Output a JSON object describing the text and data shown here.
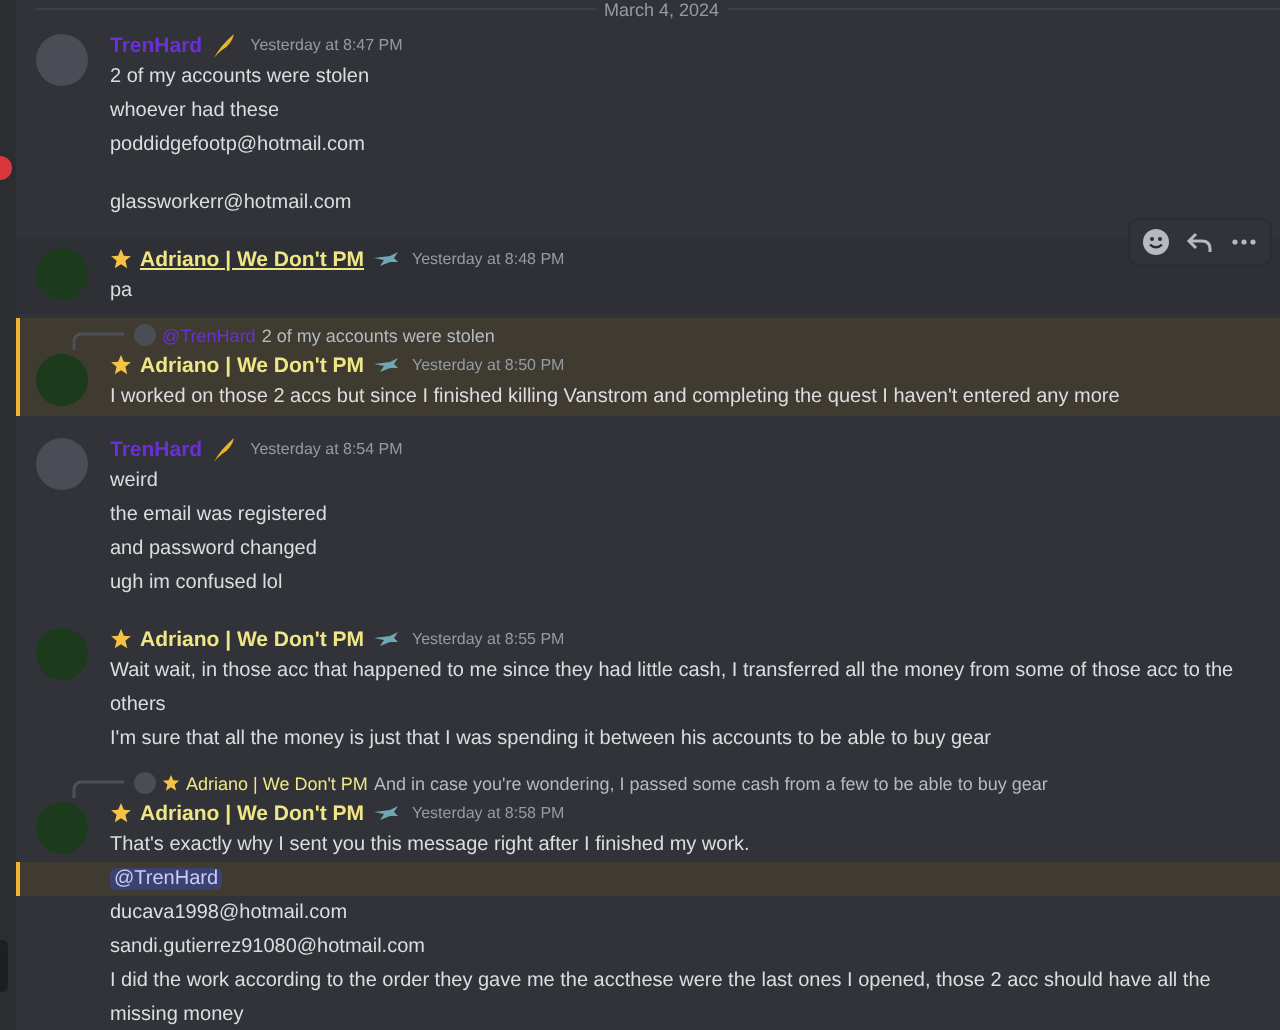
{
  "date_divider": "March 4, 2024",
  "messages": [
    {
      "author": "TrenHard",
      "color": "#6a2fd6",
      "star": false,
      "kind": "quill",
      "time": "Yesterday at 8:47 PM",
      "hovered": false,
      "highlighted": false,
      "lines": [
        {
          "kind": "text",
          "text": "2 of my accounts were stolen",
          "gap_before": false,
          "highlighted": false
        },
        {
          "kind": "text",
          "text": "whoever had these",
          "gap_before": false,
          "highlighted": false
        },
        {
          "kind": "text",
          "text": "poddidgefootp@hotmail.com",
          "gap_before": false,
          "highlighted": false
        },
        {
          "kind": "text",
          "text": "glassworkerr@hotmail.com",
          "gap_before": true,
          "highlighted": false
        }
      ]
    },
    {
      "author": "Adriano | We Don't PM",
      "color": "#f1e686",
      "star": true,
      "kind": "bird",
      "time": "Yesterday at 8:48 PM",
      "hovered": true,
      "highlighted": false,
      "lines": [
        {
          "kind": "text",
          "text": "pa",
          "gap_before": false,
          "highlighted": false
        }
      ]
    },
    {
      "author": "Adriano | We Don't PM",
      "color": "#f1e686",
      "star": true,
      "kind": "bird",
      "time": "Yesterday at 8:50 PM",
      "hovered": false,
      "highlighted": true,
      "reply": {
        "author": "@TrenHard",
        "color": "#6a2fd6",
        "star": false,
        "text": "2 of my accounts were stolen"
      },
      "lines": [
        {
          "kind": "text",
          "text": "I worked on those 2 accs but since I finished killing Vanstrom and completing the quest I haven't entered any more",
          "gap_before": false,
          "highlighted": false
        }
      ]
    },
    {
      "author": "TrenHard",
      "color": "#6a2fd6",
      "star": false,
      "kind": "quill",
      "time": "Yesterday at 8:54 PM",
      "hovered": false,
      "highlighted": false,
      "lines": [
        {
          "kind": "text",
          "text": "weird",
          "gap_before": false,
          "highlighted": false
        },
        {
          "kind": "text",
          "text": "the email was registered",
          "gap_before": false,
          "highlighted": false
        },
        {
          "kind": "text",
          "text": "and password changed",
          "gap_before": false,
          "highlighted": false
        },
        {
          "kind": "text",
          "text": "ugh im confused lol",
          "gap_before": false,
          "highlighted": false
        }
      ]
    },
    {
      "author": "Adriano | We Don't PM",
      "color": "#f1e686",
      "star": true,
      "kind": "bird",
      "time": "Yesterday at 8:55 PM",
      "hovered": false,
      "highlighted": false,
      "lines": [
        {
          "kind": "text",
          "text": "Wait wait, in those acc that happened to me since they had little cash, I transferred all the money from some of those acc to the others",
          "gap_before": false,
          "highlighted": false
        },
        {
          "kind": "text",
          "text": "I'm sure that all the money is just that I was spending it between his accounts to be able to buy gear",
          "gap_before": false,
          "highlighted": false
        }
      ]
    },
    {
      "author": "Adriano | We Don't PM",
      "color": "#f1e686",
      "star": true,
      "kind": "bird",
      "time": "Yesterday at 8:58 PM",
      "hovered": false,
      "highlighted": false,
      "reply": {
        "author": "Adriano | We Don't PM",
        "color": "#f1e686",
        "star": true,
        "text": "And in case you're wondering, I passed some cash from a few to be able to buy gear"
      },
      "lines": [
        {
          "kind": "text",
          "text": "That's exactly why I sent you this message right after I finished my work.",
          "gap_before": false,
          "highlighted": false
        },
        {
          "kind": "mention",
          "text": "@TrenHard",
          "gap_before": false,
          "highlighted": true
        },
        {
          "kind": "text",
          "text": "ducava1998@hotmail.com",
          "gap_before": false,
          "highlighted": false
        },
        {
          "kind": "text",
          "text": "sandi.gutierrez91080@hotmail.com",
          "gap_before": false,
          "highlighted": false
        },
        {
          "kind": "text",
          "text": "I did the work according to the order they gave me the accthese were the last ones I opened, those 2 acc should have all the missing money",
          "gap_before": false,
          "highlighted": false
        }
      ]
    }
  ]
}
